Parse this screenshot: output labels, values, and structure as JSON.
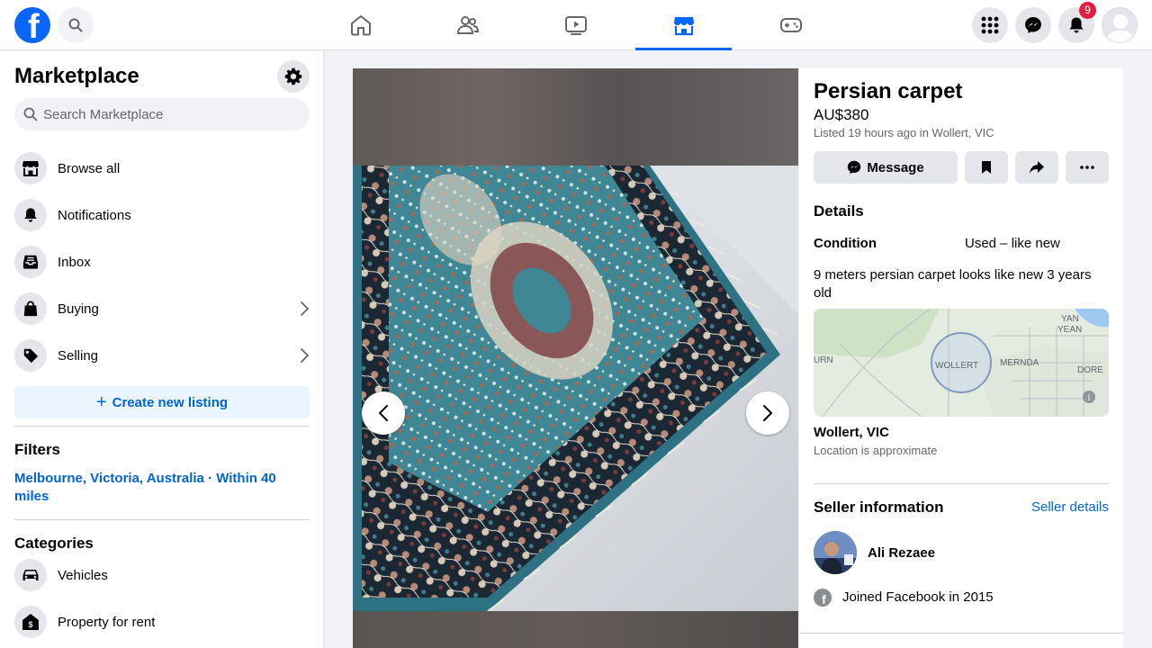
{
  "topbar": {
    "logo_letter": "f",
    "nav_tabs": [
      "home-icon",
      "friends-icon",
      "watch-icon",
      "marketplace-icon",
      "gaming-icon"
    ],
    "notification_count": "9",
    "accent_color": "#0866ff",
    "badge_color": "#e41e3f"
  },
  "sidebar": {
    "title": "Marketplace",
    "search_placeholder": "Search Marketplace",
    "items": [
      {
        "label": "Browse all",
        "icon": "store-icon"
      },
      {
        "label": "Notifications",
        "icon": "bell-icon"
      },
      {
        "label": "Inbox",
        "icon": "inbox-icon"
      },
      {
        "label": "Buying",
        "icon": "shopping-bag-icon"
      },
      {
        "label": "Selling",
        "icon": "price-tag-icon"
      }
    ],
    "create_label": "Create new listing",
    "filters_heading": "Filters",
    "filter_location": "Melbourne, Victoria, Australia · Within 40 miles",
    "categories_heading": "Categories",
    "categories": [
      {
        "label": "Vehicles",
        "icon": "car-icon"
      },
      {
        "label": "Property for rent",
        "icon": "house-dollar-icon"
      }
    ]
  },
  "listing": {
    "title": "Persian carpet",
    "price": "AU$380",
    "listed": "Listed 19 hours ago in Wollert, VIC",
    "message_label": "Message",
    "details_heading": "Details",
    "condition_key": "Condition",
    "condition_value": "Used – like new",
    "description": "9 meters persian carpet looks like new 3 years old",
    "map_labels": {
      "yan_yean_1": "YAN",
      "yan_yean_2": "YEAN",
      "urn": "URN",
      "wollert": "WOLLERT",
      "mernda": "MERNDA",
      "dore": "DORE"
    },
    "location": "Wollert, VIC",
    "location_note": "Location is approximate",
    "seller_heading": "Seller information",
    "seller_details_link": "Seller details",
    "seller_name": "Ali Rezaee",
    "joined": "Joined Facebook in 2015"
  }
}
